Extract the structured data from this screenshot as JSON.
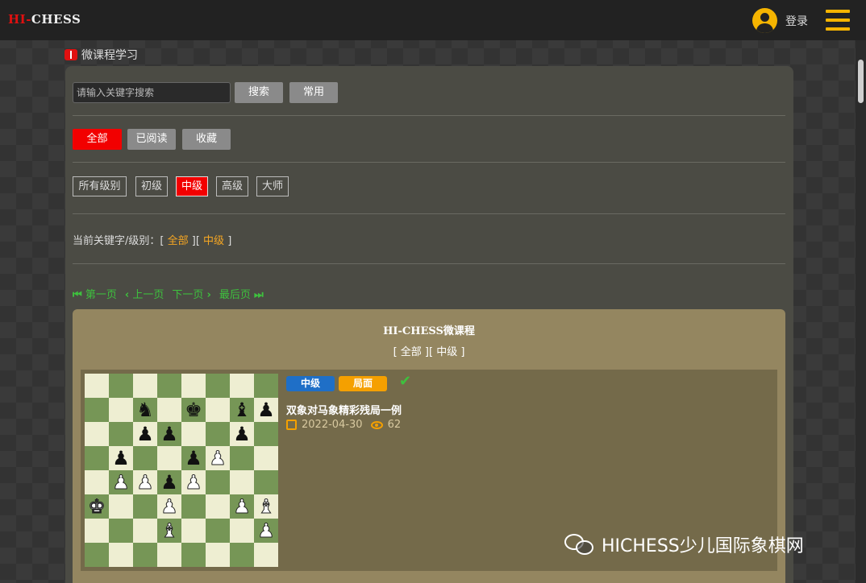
{
  "header": {
    "logo_hi": "HI-",
    "logo_chess": "CHESS",
    "login_label": "登录"
  },
  "section": {
    "title": "微课程学习"
  },
  "search": {
    "placeholder": "请输入关键字搜索",
    "search_label": "搜索",
    "common_label": "常用"
  },
  "filters": [
    {
      "label": "全部",
      "active": true
    },
    {
      "label": "已阅读",
      "active": false
    },
    {
      "label": "收藏",
      "active": false
    }
  ],
  "levels": [
    {
      "label": "所有级别",
      "active": false
    },
    {
      "label": "初级",
      "active": false
    },
    {
      "label": "中级",
      "active": true
    },
    {
      "label": "高级",
      "active": false
    },
    {
      "label": "大师",
      "active": false
    }
  ],
  "current": {
    "prefix": "当前关键字/级别：[",
    "keyword": "全部",
    "mid": "][",
    "level": "中级",
    "suffix": "]"
  },
  "pager": {
    "first": "第一页",
    "prev": "上一页",
    "next": "下一页",
    "last": "最后页"
  },
  "course": {
    "title": "HI-CHESS微课程",
    "subtitle": "[ 全部 ][ 中级 ]",
    "card": {
      "tag_level": "中级",
      "tag_type": "局面",
      "title": "双象对马象精彩残局一例",
      "date": "2022-04-30",
      "views": "62",
      "board": [
        "........",
        "..n.k.bp",
        "..pp..p.",
        ".p..pP..",
        ".PPpP...",
        "K..P..PB",
        "...B...P",
        "........"
      ]
    }
  },
  "watermark": {
    "text": "HICHESS少儿国际象棋网"
  },
  "colors": {
    "accent_red": "#f20000",
    "accent_orange": "#f5a000",
    "accent_green": "#3ec13e",
    "tag_blue": "#1f6fc7"
  }
}
